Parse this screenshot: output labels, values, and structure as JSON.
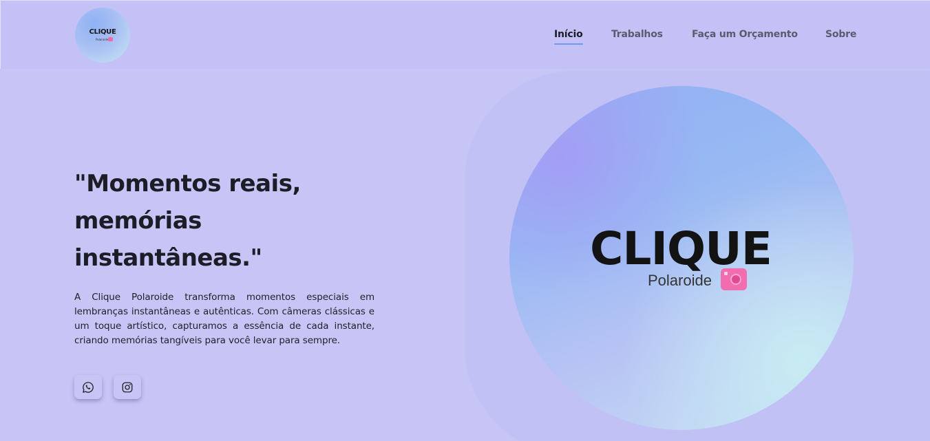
{
  "brand": {
    "name": "CLIQUE",
    "subtitle": "Polaroide"
  },
  "nav": {
    "items": [
      {
        "label": "Início",
        "active": true
      },
      {
        "label": "Trabalhos",
        "active": false
      },
      {
        "label": "Faça um Orçamento",
        "active": false
      },
      {
        "label": "Sobre",
        "active": false
      }
    ]
  },
  "hero": {
    "headline_lines": [
      "\"Momentos reais,",
      "memórias",
      "instantâneas.\""
    ],
    "description": "A Clique Polaroide transforma momentos especiais em lembranças instantâneas e autênticas. Com câmeras clássicas e um toque artístico, capturamos a essência de cada instante, criando memórias tangíveis para você levar para sempre."
  },
  "social": [
    {
      "icon": "whatsapp-icon"
    },
    {
      "icon": "instagram-icon"
    }
  ],
  "colors": {
    "background": "#c6c5f5",
    "header": "#c3c1f6",
    "nav_active_underline": "#6f9cf2",
    "camera_pink": "#f16db0",
    "text_dark": "#1d1d27"
  }
}
